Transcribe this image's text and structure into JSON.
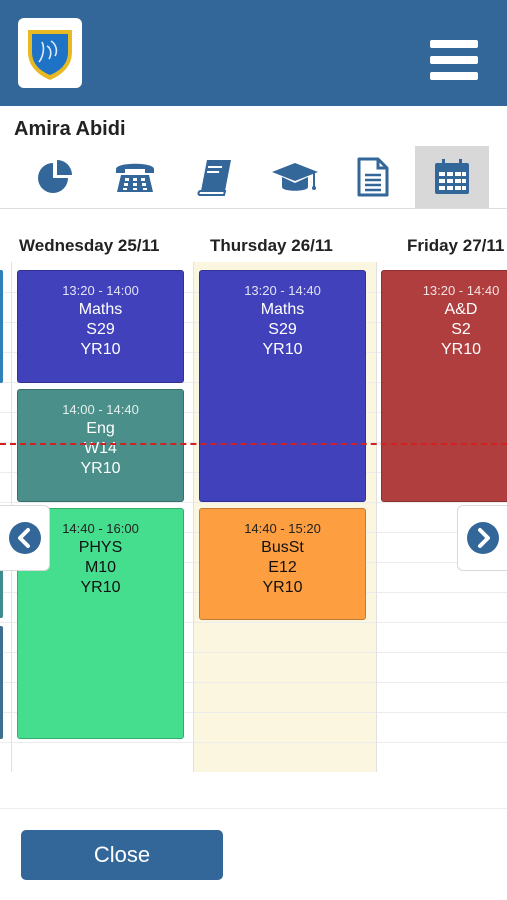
{
  "theme": {
    "header_bg": "#336699",
    "accent": "#336699",
    "shield_blue": "#1f73c7",
    "shield_gold": "#e8b923",
    "now_line": "#d42020",
    "today_column": "#faf6df"
  },
  "header": {
    "logo": "school-shield-logo",
    "menu_icon": "hamburger-icon"
  },
  "student": {
    "name": "Amira Abidi"
  },
  "toolbar": {
    "items": [
      {
        "icon": "pie-chart-icon",
        "active": false
      },
      {
        "icon": "telephone-icon",
        "active": false
      },
      {
        "icon": "book-icon",
        "active": false
      },
      {
        "icon": "graduation-cap-icon",
        "active": false
      },
      {
        "icon": "document-icon",
        "active": false
      },
      {
        "icon": "calendar-icon",
        "active": true
      }
    ]
  },
  "timetable": {
    "days": [
      {
        "label": "Wednesday 25/11"
      },
      {
        "label": "Thursday 26/11"
      },
      {
        "label": "Friday 27/11"
      }
    ],
    "lessons": {
      "wed_1": {
        "time": "13:20 - 14:00",
        "subject": "Maths",
        "room": "S29",
        "group": "YR10",
        "color": "#4141bb"
      },
      "wed_2": {
        "time": "14:00 - 14:40",
        "subject": "Eng",
        "room": "W14",
        "group": "YR10",
        "color": "#4a8f8a"
      },
      "wed_3": {
        "time": "14:40 - 16:00",
        "subject": "PHYS",
        "room": "M10",
        "group": "YR10",
        "color": "#45dd8e"
      },
      "thu_1": {
        "time": "13:20 - 14:40",
        "subject": "Maths",
        "room": "S29",
        "group": "YR10",
        "color": "#4141bb"
      },
      "thu_2": {
        "time": "14:40 - 15:20",
        "subject": "BusSt",
        "room": "E12",
        "group": "YR10",
        "color": "#fd9e40"
      },
      "fri_1": {
        "time": "13:20 - 14:40",
        "subject": "A&D",
        "room": "S2",
        "group": "YR10",
        "color": "#b03e3e"
      }
    },
    "prev_icon": "chevron-left-circle-icon",
    "next_icon": "chevron-right-circle-icon"
  },
  "footer": {
    "close_label": "Close"
  }
}
